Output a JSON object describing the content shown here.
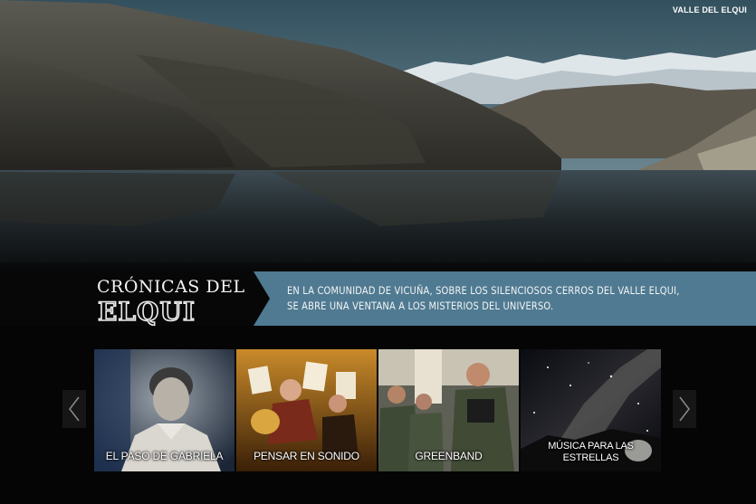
{
  "header": {
    "site_label": "VALLE DEL ELQUI"
  },
  "banner": {
    "logo_line1": "CRÓNICAS DEL",
    "logo_line2": "ELQUI",
    "tagline_line1": "EN LA COMUNIDAD DE VICUÑA, SOBRE LOS SILENCIOSOS CERROS DEL VALLE ELQUI,",
    "tagline_line2": "SE ABRE UNA VENTANA A LOS MISTERIOS DEL UNIVERSO."
  },
  "carousel": {
    "prev_icon": "chevron-left-icon",
    "next_icon": "chevron-right-icon",
    "items": [
      {
        "title": "EL PASO DE GABRIELA"
      },
      {
        "title": "PENSAR EN SONIDO"
      },
      {
        "title": "GREENBAND"
      },
      {
        "title_line1": "MÚSICA PARA LAS",
        "title_line2": "ESTRELLAS"
      }
    ]
  },
  "colors": {
    "ribbon": "#4f7a92",
    "background": "#050505"
  }
}
